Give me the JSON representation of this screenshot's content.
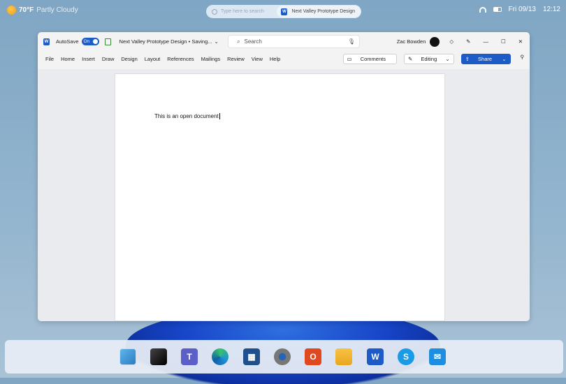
{
  "topbar": {
    "temperature": "70°F",
    "condition": "Partly Cloudy",
    "search_placeholder": "Type here to search",
    "active_doc": "Next Valley Prototype Design",
    "date": "Fri 09/13",
    "time": "12:12"
  },
  "window": {
    "autosave_label": "AutoSave",
    "autosave_state": "On",
    "title": "Next Valley Prototype Design • Saving...",
    "search_placeholder": "Search",
    "user": "Zac Bowden",
    "menu": [
      "File",
      "Home",
      "Insert",
      "Draw",
      "Design",
      "Layout",
      "References",
      "Mailings",
      "Review",
      "View",
      "Help"
    ],
    "comments_label": "Comments",
    "editing_label": "Editing",
    "share_label": "Share"
  },
  "document": {
    "text": "This is an open document"
  },
  "taskbar": {
    "apps": [
      "start",
      "task-view",
      "teams",
      "edge",
      "store",
      "settings",
      "office",
      "file-explorer",
      "word",
      "skype",
      "mail"
    ]
  }
}
